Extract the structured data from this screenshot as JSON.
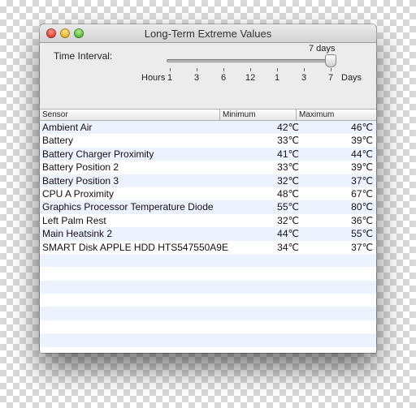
{
  "window": {
    "title": "Long-Term Extreme Values"
  },
  "controls": {
    "time_interval_label": "Time Interval:",
    "slider_value": "7 days",
    "hours_label": "Hours",
    "days_label": "Days",
    "ticks": [
      "1",
      "3",
      "6",
      "12",
      "1",
      "3",
      "7"
    ],
    "slider_position_fraction": 1.0
  },
  "table": {
    "columns": [
      "Sensor",
      "Minimum",
      "Maximum"
    ],
    "rows": [
      {
        "sensor": "Ambient Air",
        "min": "42℃",
        "max": "46℃"
      },
      {
        "sensor": "Battery",
        "min": "33℃",
        "max": "39℃"
      },
      {
        "sensor": "Battery Charger Proximity",
        "min": "41℃",
        "max": "44℃"
      },
      {
        "sensor": "Battery Position 2",
        "min": "33℃",
        "max": "39℃"
      },
      {
        "sensor": "Battery Position 3",
        "min": "32℃",
        "max": "37℃"
      },
      {
        "sensor": "CPU A Proximity",
        "min": "48℃",
        "max": "67℃"
      },
      {
        "sensor": "Graphics Processor Temperature Diode",
        "min": "55℃",
        "max": "80℃"
      },
      {
        "sensor": "Left Palm Rest",
        "min": "32℃",
        "max": "36℃"
      },
      {
        "sensor": "Main Heatsink 2",
        "min": "44℃",
        "max": "55℃"
      },
      {
        "sensor": "SMART Disk APPLE HDD HTS547550A9E",
        "min": "34℃",
        "max": "37℃"
      }
    ]
  },
  "colors": {
    "row_alternate": "#edf3fe",
    "close": "#e0443a",
    "minimize": "#e6b330",
    "zoom": "#5dbb3c"
  },
  "icons": [
    "close-button-icon",
    "minimize-button-icon",
    "zoom-button-icon"
  ]
}
